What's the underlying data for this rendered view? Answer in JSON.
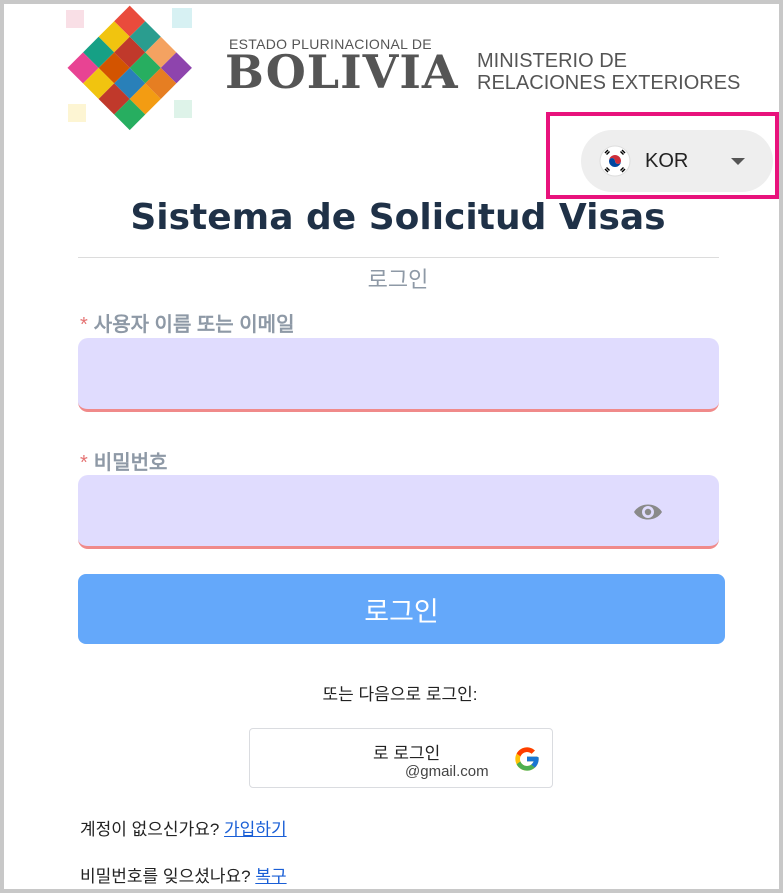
{
  "header": {
    "estado": "ESTADO PLURINACIONAL DE",
    "country": "BOLIVIA",
    "ministry_line1": "MINISTERIO DE",
    "ministry_line2": "RELACIONES EXTERIORES"
  },
  "language_selector": {
    "value": "KOR",
    "flag_icon": "south-korea-flag-icon"
  },
  "title": "Sistema de Solicitud Visas",
  "subtitle": "로그인",
  "form": {
    "required_mark": "*",
    "username_label": "사용자 이름 또는 이메일",
    "password_label": "비밀번호",
    "login_button": "로그인"
  },
  "alt_login": {
    "prompt": "또는 다음으로 로그인:",
    "google_line1": "로 로그인",
    "google_line2": "@gmail.com"
  },
  "footer": {
    "signup_prompt": "계정이 없으신가요?",
    "signup_link": "가입하기",
    "recover_prompt": "비밀번호를 잊으셨나요?",
    "recover_link": "복구"
  },
  "colors": {
    "accent": "#64a8fa",
    "input_bg": "#e0dcfe",
    "error_underline": "#f08a8a",
    "highlight": "#e8127c",
    "title": "#1f3147"
  }
}
